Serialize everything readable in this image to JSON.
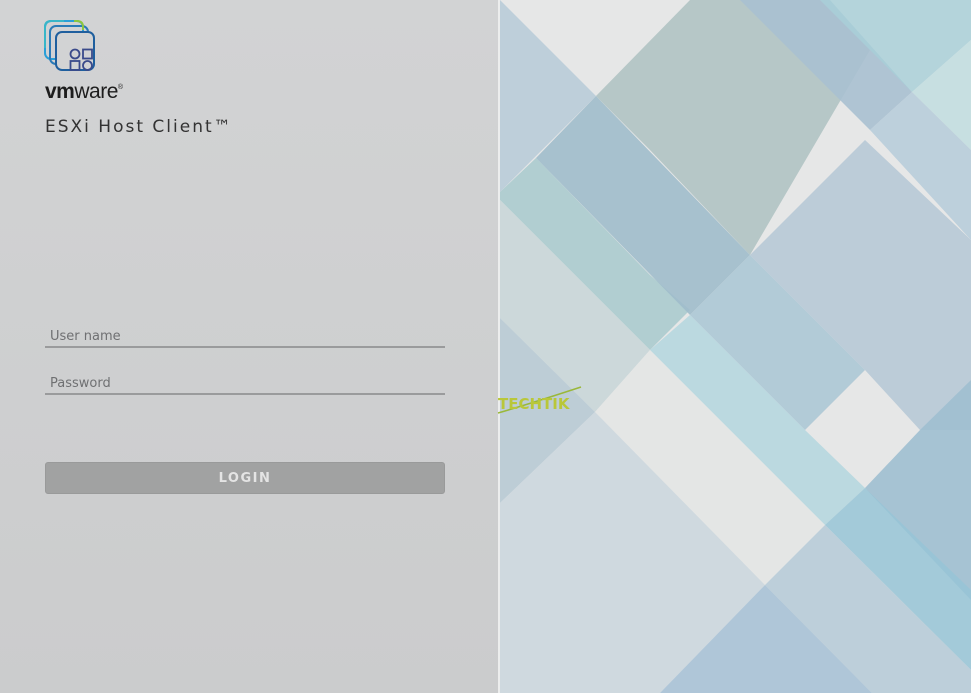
{
  "brand": {
    "logo_vm": "vm",
    "logo_ware": "ware",
    "registered": "®",
    "product": "ESXi Host Client™",
    "logo_icon": "vmware-apps-icon"
  },
  "login": {
    "username_placeholder": "User name",
    "password_placeholder": "Password",
    "button_label": "LOGIN"
  },
  "watermark": {
    "text": "TECHTIK"
  },
  "colors": {
    "panel": "#cdcecf",
    "button": "#a1a2a2",
    "logo_blue": "#2a7bb8",
    "logo_green": "#8cc63f",
    "logo_navy": "#3a4a8a"
  }
}
